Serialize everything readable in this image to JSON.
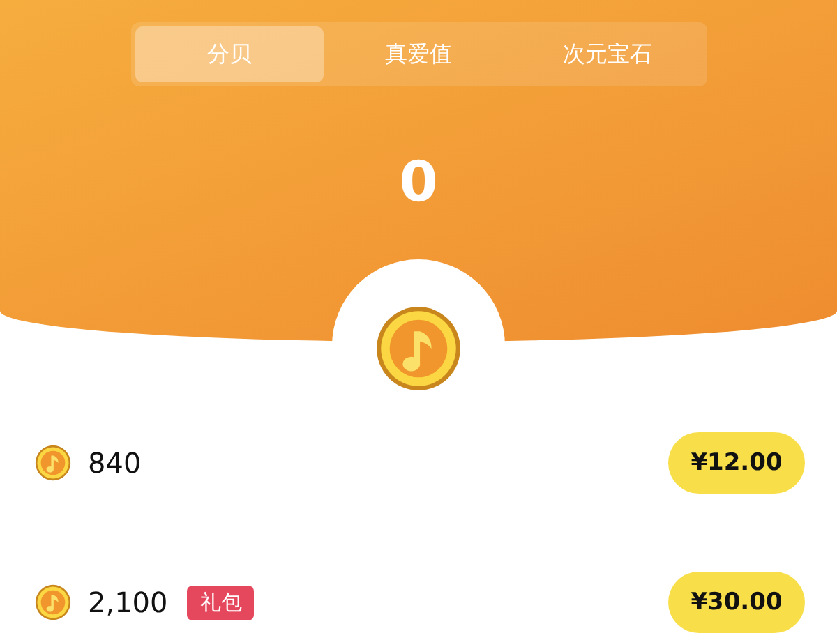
{
  "tabs": [
    {
      "label": "分贝",
      "selected": true
    },
    {
      "label": "真爱值",
      "selected": false
    },
    {
      "label": "次元宝石",
      "selected": false
    }
  ],
  "balance": "0",
  "packages": [
    {
      "amount": "840",
      "price": "¥12.00"
    },
    {
      "amount": "2,100",
      "tag": "礼包",
      "price": "¥30.00"
    }
  ]
}
